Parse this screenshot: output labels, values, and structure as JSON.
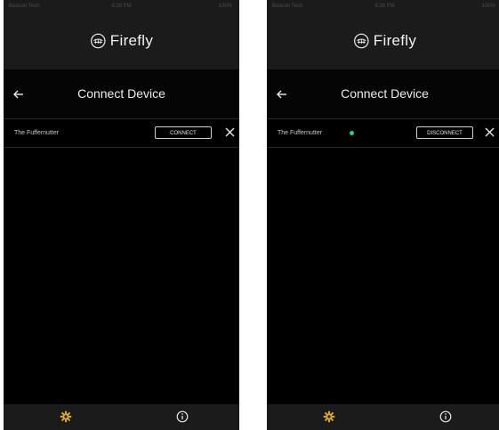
{
  "colors": {
    "header_bg": "#1b1b1b",
    "screen_bg": "#000000",
    "accent_gold": "#e0a81a",
    "connected_green": "#1fd38a",
    "text_primary": "#ececec"
  },
  "screens": [
    {
      "id": "left",
      "status_bar": {
        "carrier": "Beacon Tech",
        "time": "6:38 PM",
        "battery": "100%"
      },
      "logo_text": "Firefly",
      "nav": {
        "title": "Connect Device",
        "back_icon": "back-arrow-icon"
      },
      "device": {
        "name": "The Fuffernutter",
        "connected": false,
        "action_label": "CONNECT",
        "remove_icon": "close-icon"
      },
      "tabs": [
        {
          "icon": "settings-gear-icon"
        },
        {
          "icon": "info-icon"
        }
      ]
    },
    {
      "id": "right",
      "status_bar": {
        "carrier": "Beacon Tech",
        "time": "6:38 PM",
        "battery": "100%"
      },
      "logo_text": "Firefly",
      "nav": {
        "title": "Connect Device",
        "back_icon": "back-arrow-icon"
      },
      "device": {
        "name": "The Fuffernutter",
        "connected": true,
        "action_label": "DISCONNECT",
        "remove_icon": "close-icon"
      },
      "tabs": [
        {
          "icon": "settings-gear-icon"
        },
        {
          "icon": "info-icon"
        }
      ]
    }
  ]
}
